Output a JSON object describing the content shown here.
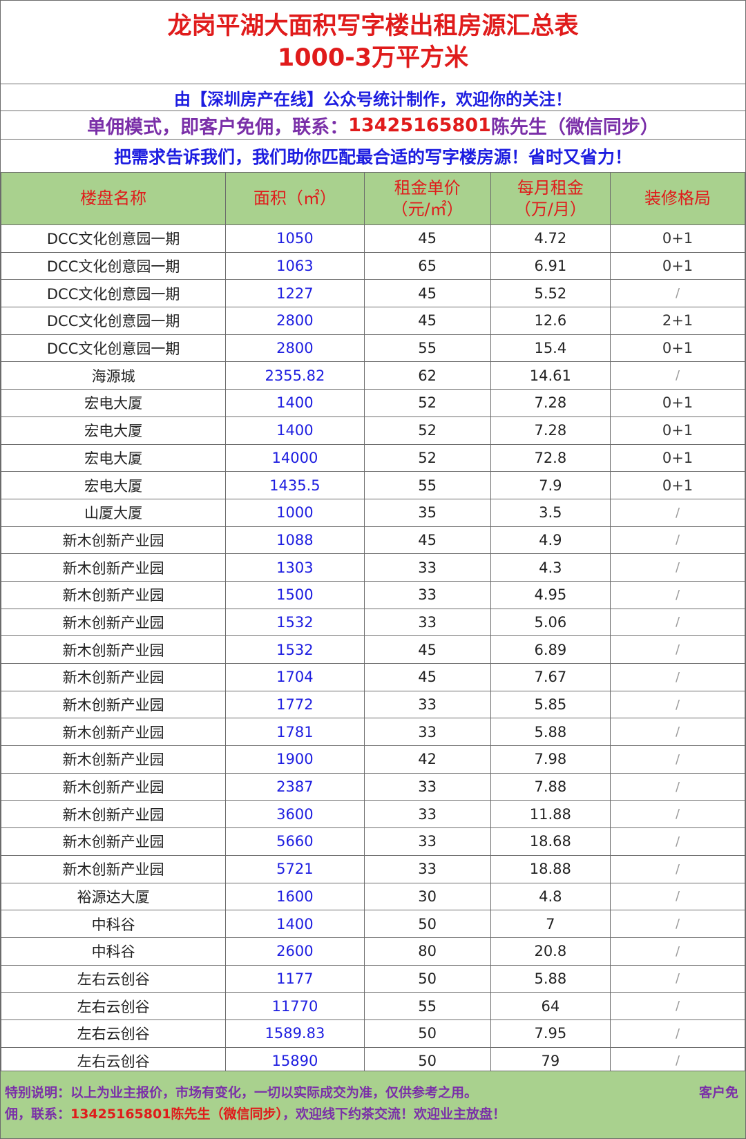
{
  "title": {
    "line1": "龙岗平湖大面积写字楼出租房源汇总表",
    "line2": "1000-3万平方米"
  },
  "banners": {
    "source": "由【深圳房产在线】公众号统计制作，欢迎你的关注！",
    "contact_prefix": "单佣模式，即客户免佣，联系：",
    "contact_phone": "13425165801",
    "contact_suffix": " 陈先生（微信同步）",
    "slogan": "把需求告诉我们，我们助你匹配最合适的写字楼房源！省时又省力！"
  },
  "table": {
    "headers": [
      {
        "l1": "楼盘名称",
        "l2": ""
      },
      {
        "l1": "面积（㎡）",
        "l2": ""
      },
      {
        "l1": "租金单价",
        "l2": "（元/㎡）"
      },
      {
        "l1": "每月租金",
        "l2": "（万/月）"
      },
      {
        "l1": "装修格局",
        "l2": ""
      }
    ],
    "rows": [
      [
        "DCC文化创意园一期",
        "1050",
        "45",
        "4.72",
        "0+1"
      ],
      [
        "DCC文化创意园一期",
        "1063",
        "65",
        "6.91",
        "0+1"
      ],
      [
        "DCC文化创意园一期",
        "1227",
        "45",
        "5.52",
        "/"
      ],
      [
        "DCC文化创意园一期",
        "2800",
        "45",
        "12.6",
        "2+1"
      ],
      [
        "DCC文化创意园一期",
        "2800",
        "55",
        "15.4",
        "0+1"
      ],
      [
        "海源城",
        "2355.82",
        "62",
        "14.61",
        "/"
      ],
      [
        "宏电大厦",
        "1400",
        "52",
        "7.28",
        "0+1"
      ],
      [
        "宏电大厦",
        "1400",
        "52",
        "7.28",
        "0+1"
      ],
      [
        "宏电大厦",
        "14000",
        "52",
        "72.8",
        "0+1"
      ],
      [
        "宏电大厦",
        "1435.5",
        "55",
        "7.9",
        "0+1"
      ],
      [
        "山厦大厦",
        "1000",
        "35",
        "3.5",
        "/"
      ],
      [
        "新木创新产业园",
        "1088",
        "45",
        "4.9",
        "/"
      ],
      [
        "新木创新产业园",
        "1303",
        "33",
        "4.3",
        "/"
      ],
      [
        "新木创新产业园",
        "1500",
        "33",
        "4.95",
        "/"
      ],
      [
        "新木创新产业园",
        "1532",
        "33",
        "5.06",
        "/"
      ],
      [
        "新木创新产业园",
        "1532",
        "45",
        "6.89",
        "/"
      ],
      [
        "新木创新产业园",
        "1704",
        "45",
        "7.67",
        "/"
      ],
      [
        "新木创新产业园",
        "1772",
        "33",
        "5.85",
        "/"
      ],
      [
        "新木创新产业园",
        "1781",
        "33",
        "5.88",
        "/"
      ],
      [
        "新木创新产业园",
        "1900",
        "42",
        "7.98",
        "/"
      ],
      [
        "新木创新产业园",
        "2387",
        "33",
        "7.88",
        "/"
      ],
      [
        "新木创新产业园",
        "3600",
        "33",
        "11.88",
        "/"
      ],
      [
        "新木创新产业园",
        "5660",
        "33",
        "18.68",
        "/"
      ],
      [
        "新木创新产业园",
        "5721",
        "33",
        "18.88",
        "/"
      ],
      [
        "裕源达大厦",
        "1600",
        "30",
        "4.8",
        "/"
      ],
      [
        "中科谷",
        "1400",
        "50",
        "7",
        "/"
      ],
      [
        "中科谷",
        "2600",
        "80",
        "20.8",
        "/"
      ],
      [
        "左右云创谷",
        "1177",
        "50",
        "5.88",
        "/"
      ],
      [
        "左右云创谷",
        "11770",
        "55",
        "64",
        "/"
      ],
      [
        "左右云创谷",
        "1589.83",
        "50",
        "7.95",
        "/"
      ],
      [
        "左右云创谷",
        "15890",
        "50",
        "79",
        "/"
      ]
    ]
  },
  "note": {
    "line1": "特别说明：以上为业主报价，市场有变化，一切以实际成交为准，仅供参考之用。",
    "line1_right": "客户免",
    "line2_prefix": "佣，联系：",
    "line2_phone": "13425165801陈先生（微信同步）",
    "line2_suffix": "，欢迎线下约茶交流！欢迎业主放盘！"
  },
  "colors": {
    "title_red": "#e01b1b",
    "header_green": "#a9d18e",
    "area_blue": "#1d1de0",
    "contact_purple": "#7a2fa8"
  }
}
